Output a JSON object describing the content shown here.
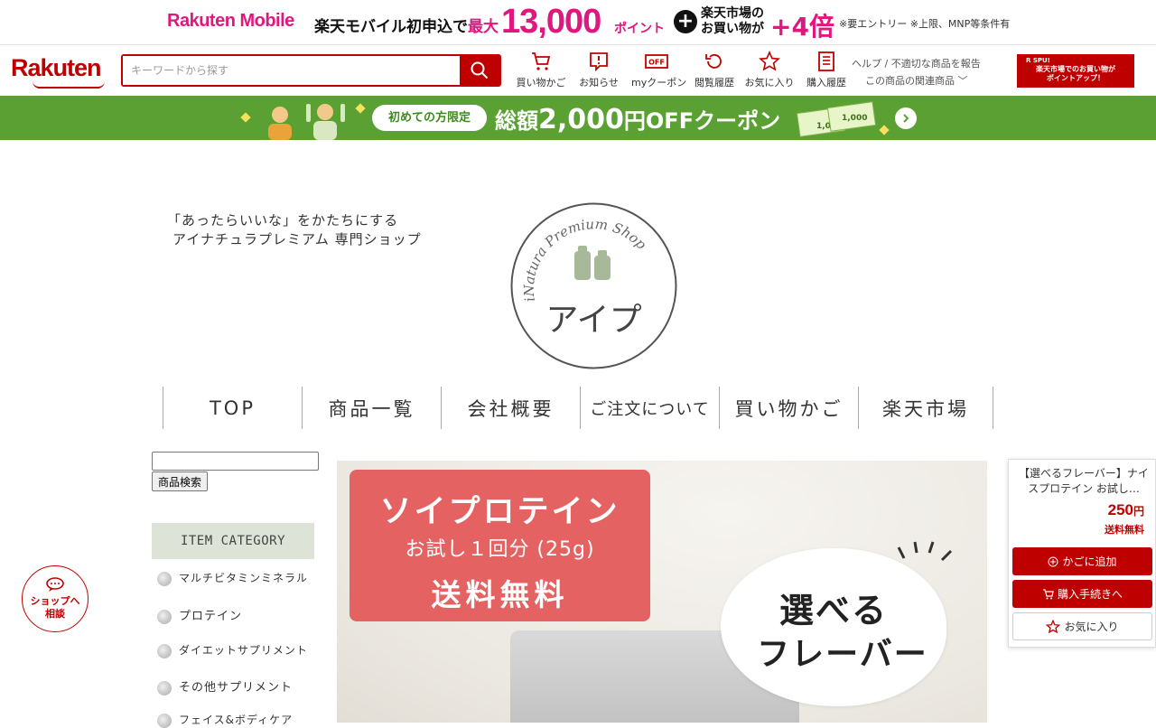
{
  "promo": {
    "brand": "Rakuten Mobile",
    "text_prefix": "楽天モバイル初申込で",
    "text_max": "最大",
    "amount": "13,000",
    "point": "ポイント",
    "plus": "+",
    "ichiba_line1": "楽天市場の",
    "ichiba_line2": "お買い物が",
    "multiplier": "+4倍",
    "note": "※要エントリー ※上限、MNP等条件有"
  },
  "header": {
    "logo": "Rakuten",
    "search_placeholder": "キーワードから探す",
    "icons": [
      {
        "label": "買い物かご",
        "icon": "cart-icon"
      },
      {
        "label": "お知らせ",
        "icon": "notice-icon"
      },
      {
        "label": "myクーポン",
        "icon": "coupon-icon",
        "badge": "OFF"
      },
      {
        "label": "閲覧履歴",
        "icon": "history-icon"
      },
      {
        "label": "お気に入り",
        "icon": "star-icon"
      },
      {
        "label": "購入履歴",
        "icon": "receipt-icon"
      }
    ],
    "help": "ヘルプ / 不適切な商品を報告",
    "related": "この商品の関連商品",
    "spu_tag": "R SPU!",
    "spu_text1": "楽天市場でのお買い物が",
    "spu_text2": "ポイントアップ！"
  },
  "coupon": {
    "pill": "初めての方限定",
    "main_prefix": "総額",
    "main_amount": "2,000",
    "main_suffix": "円OFFクーポン",
    "bill1": "1,000",
    "bill2": "1,000"
  },
  "shop": {
    "tagline1": "「あったらいいな」をかたちにする",
    "tagline2": "アイナチュラプレミアム 専門ショップ",
    "logo_arc": "iNatura Premium Shop",
    "logo_name": "アイプ"
  },
  "nav": [
    "TOP",
    "商品一覧",
    "会社概要",
    "ご注文について",
    "買い物かご",
    "楽天市場"
  ],
  "sidebar": {
    "search_button": "商品検索",
    "category_title": "ITEM CATEGORY",
    "categories": [
      "マルチビタミンミネラル",
      "プロテイン",
      "ダイエットサプリメント",
      "その他サプリメント",
      "フェイス&ボディケア"
    ]
  },
  "hero": {
    "title": "ソイプロテイン",
    "subtitle": "お試し１回分 (25g)",
    "shipping": "送料無料",
    "bubble1": "選べる",
    "bubble2": "フレーバー"
  },
  "card": {
    "name": "【選べるフレーバー】ナイスプロテイン お試し…",
    "price": "250",
    "currency": "円",
    "shipping": "送料無料",
    "add_cart": "かごに追加",
    "buy": "購入手続きへ",
    "favorite": "お気に入り"
  },
  "chat": {
    "line1": "ショップへ",
    "line2": "相談"
  },
  "colors": {
    "rakuten_red": "#bf0000",
    "mobile_pink": "#e0177e",
    "coupon_green": "#5aa032"
  }
}
